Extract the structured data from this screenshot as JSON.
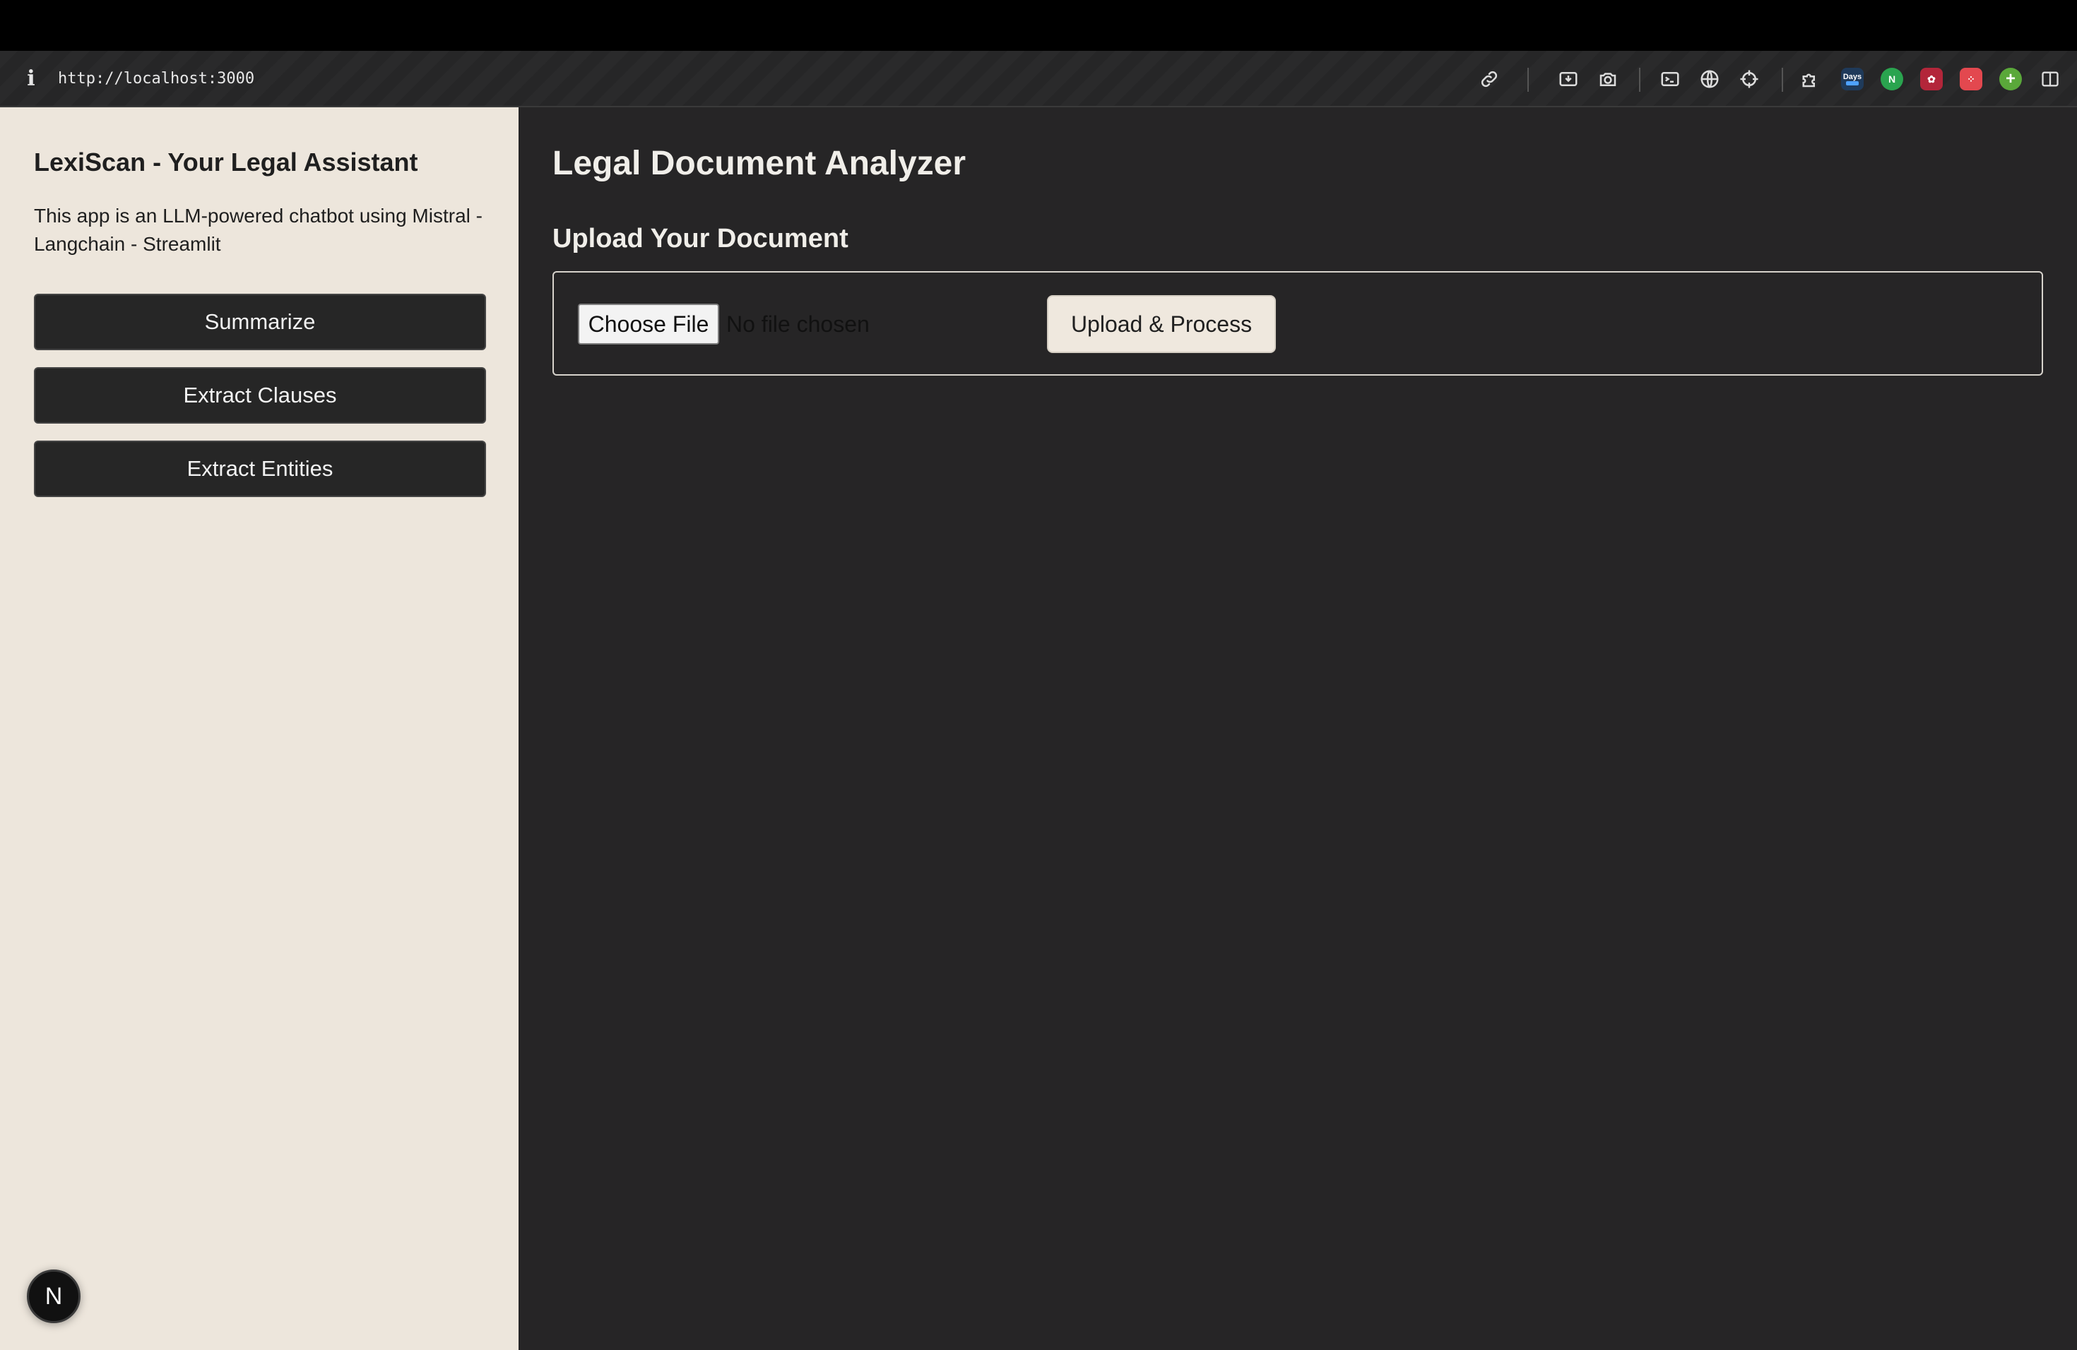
{
  "browser": {
    "url": "http://localhost:3000",
    "info_icon": "i",
    "toolbar_icons": [
      "link-icon",
      "download-icon",
      "camera-icon",
      "terminal-icon",
      "globe-icon",
      "crosshair-icon",
      "extension-puzzle-icon",
      "days-extension-icon",
      "n-extension-icon",
      "red-extension-icon",
      "dice-extension-icon",
      "plus-extension-icon",
      "sidebar-toggle-icon"
    ],
    "days_ext_label": "Days"
  },
  "sidebar": {
    "title": "LexiScan - Your Legal Assistant",
    "description": "This app is an LLM-powered chatbot using Mistral - Langchain - Streamlit",
    "buttons": [
      {
        "label": "Summarize"
      },
      {
        "label": "Extract Clauses"
      },
      {
        "label": "Extract Entities"
      }
    ],
    "badge": "N"
  },
  "main": {
    "title": "Legal Document Analyzer",
    "upload_heading": "Upload Your Document",
    "choose_file_label": "Choose File",
    "no_file_text": "No file chosen",
    "upload_button_label": "Upload & Process"
  },
  "colors": {
    "sidebar_bg": "#ede6dc",
    "main_bg": "#262526",
    "button_dark": "#262626",
    "upload_button_bg": "#efe8de"
  }
}
